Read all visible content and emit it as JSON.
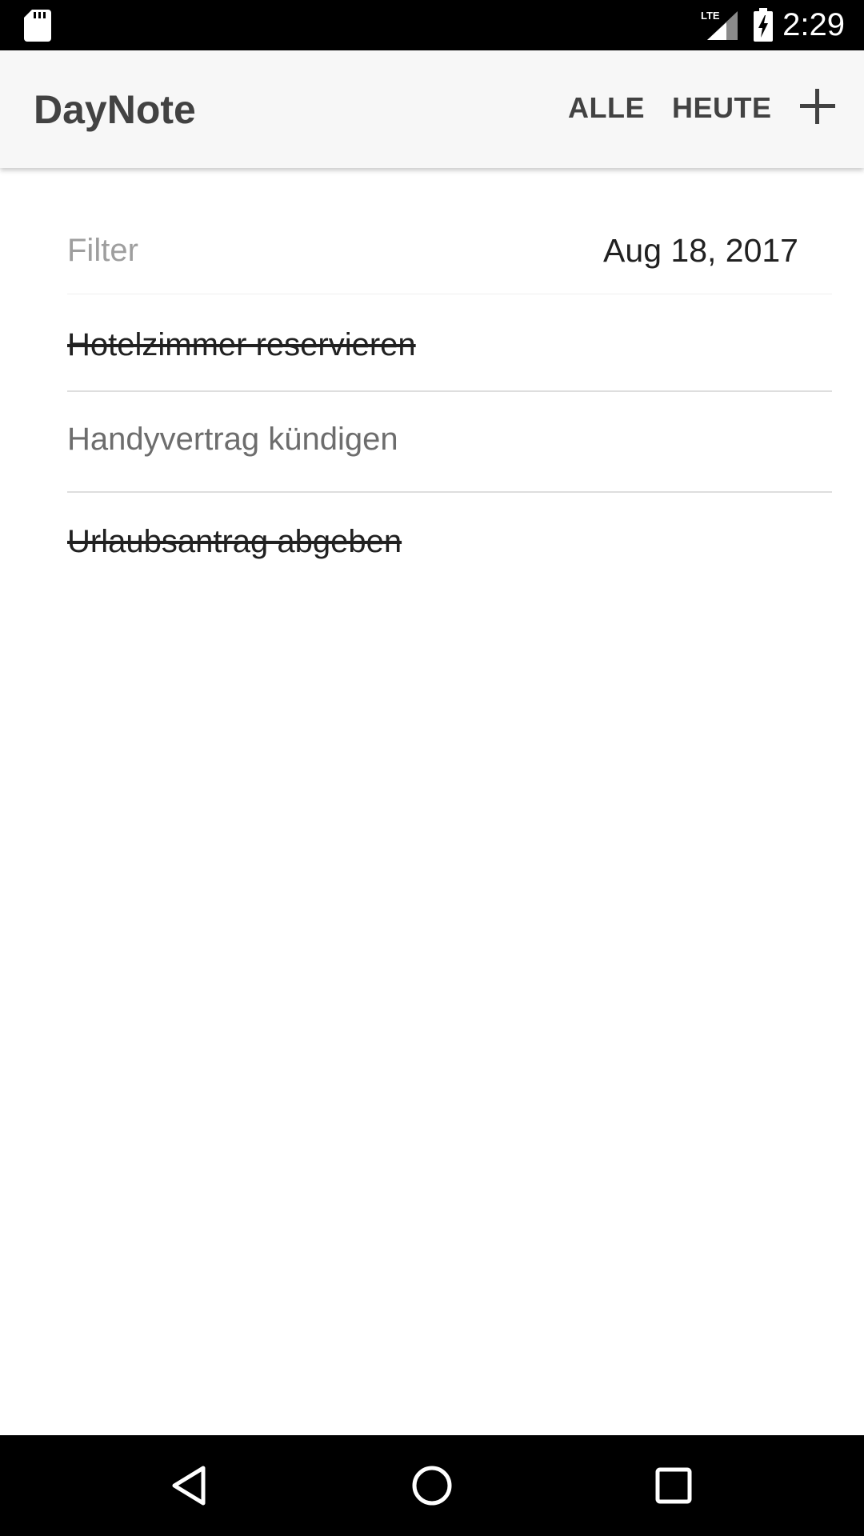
{
  "status_bar": {
    "time": "2:29",
    "network_label": "LTE",
    "icons": [
      "sd-card-icon",
      "lte-signal-icon",
      "battery-charging-icon"
    ]
  },
  "app_bar": {
    "title": "DayNote",
    "actions": {
      "all_label": "ALLE",
      "today_label": "HEUTE",
      "add_icon": "plus-icon"
    }
  },
  "filter": {
    "placeholder": "Filter",
    "value": "",
    "date": "Aug 18, 2017"
  },
  "notes": [
    {
      "text": "Hotelzimmer reservieren",
      "done": true
    },
    {
      "text": "Handyvertrag kündigen",
      "done": false
    },
    {
      "text": "Urlaubsantrag abgeben",
      "done": true
    }
  ],
  "nav_bar": {
    "icons": [
      "back-icon",
      "home-icon",
      "recents-icon"
    ]
  },
  "colors": {
    "app_bar_background": "#f7f7f7",
    "title_text": "#424242",
    "done_text": "#212121",
    "open_text": "#6d6d6d",
    "divider": "#dedede",
    "system_bars": "#000000"
  }
}
